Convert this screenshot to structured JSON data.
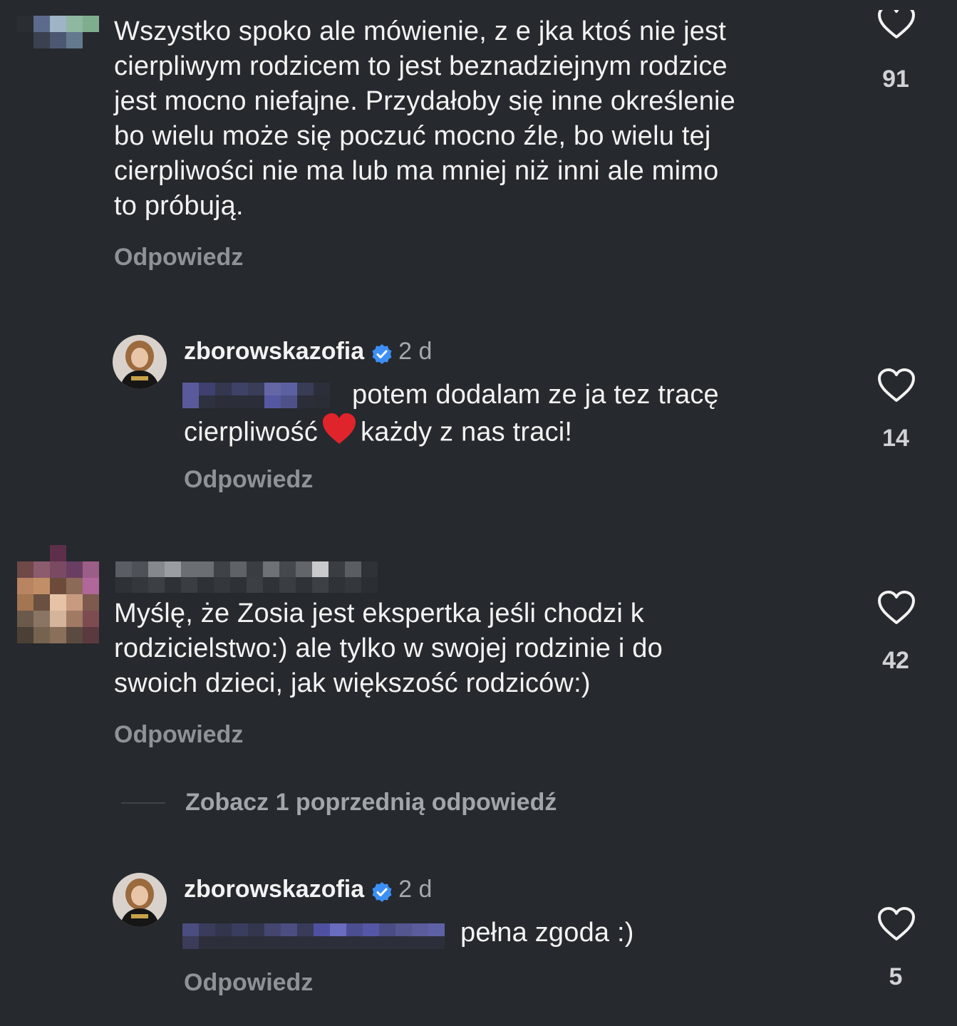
{
  "comments": [
    {
      "username": "",
      "text": "Wszystko spoko ale mówienie, z e jka ktoś nie jest\ncierpliwym rodzicem to jest beznadziejnym rodzice\njest mocno niefajne. Przydałoby się inne określenie\nbo wielu może się poczuć mocno źle, bo wielu tej\ncierpliwości nie ma lub ma mniej niż inni ale mimo\nto próbują.",
      "reply_label": "Odpowiedz",
      "likes": "91",
      "username_pixelated": true
    },
    {
      "username": "zborowskazofia",
      "verified": true,
      "time": "2 d",
      "mention_pixelated": true,
      "text": "potem dodalam ze ja tez tracę\ncierpliwość ❤️ każdy z nas traci!",
      "text_line1": "potem dodalam ze ja tez tracę",
      "text_line2_a": "cierpliwość",
      "text_line2_emoji": "❤️",
      "text_line2_b": "każdy z nas traci!",
      "reply_label": "Odpowiedz",
      "likes": "14"
    },
    {
      "username": "",
      "username_pixelated": true,
      "text": "Myślę, że Zosia jest ekspertka jeśli chodzi k\nrodzicielstwo:) ale tylko w swojej rodzinie i do\nswoich dzieci, jak większość rodziców:)",
      "reply_label": "Odpowiedz",
      "likes": "42"
    },
    {
      "username": "zborowskazofia",
      "verified": true,
      "time": "2 d",
      "mention_pixelated": true,
      "text": "pełna zgoda :)",
      "reply_label": "Odpowiedz",
      "likes": "5"
    }
  ],
  "view_previous_replies": "Zobacz 1 poprzednią odpowiedź",
  "colors": {
    "background": "#26292d",
    "text": "#f3f3f3",
    "muted": "#8f9398",
    "verified_badge": "#3d8ff5",
    "heart_emoji": "#e0242b"
  },
  "icons": {
    "like": "heart-outline-icon",
    "verified": "verified-badge-icon"
  }
}
